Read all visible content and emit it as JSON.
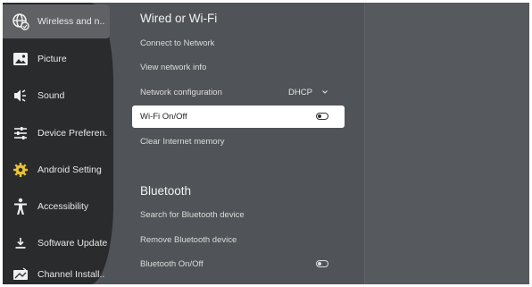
{
  "sidebar": {
    "items": [
      {
        "label": "Wireless and n..",
        "icon": "globe-network-icon",
        "selected": true
      },
      {
        "label": "Picture",
        "icon": "picture-icon"
      },
      {
        "label": "Sound",
        "icon": "speaker-icon"
      },
      {
        "label": "Device Preferen..",
        "icon": "sliders-icon"
      },
      {
        "label": "Android Setting",
        "icon": "gear-icon"
      },
      {
        "label": "Accessibility",
        "icon": "accessibility-person-icon"
      },
      {
        "label": "Software Update",
        "icon": "download-icon"
      },
      {
        "label": "Channel Install..",
        "icon": "tv-antenna-icon"
      }
    ]
  },
  "wired": {
    "title": "Wired or Wi-Fi",
    "items": [
      {
        "label": "Connect to Network"
      },
      {
        "label": "View network info"
      },
      {
        "label": "Network configuration",
        "value": "DHCP"
      },
      {
        "label": "Wi-Fi On/Off",
        "focused": true,
        "toggle": "off"
      },
      {
        "label": "Clear Internet memory"
      }
    ]
  },
  "bluetooth": {
    "title": "Bluetooth",
    "items": [
      {
        "label": "Search for Bluetooth device"
      },
      {
        "label": "Remove Bluetooth device"
      },
      {
        "label": "Bluetooth On/Off",
        "toggle": "off"
      }
    ]
  },
  "colors": {
    "sidebar_bg": "#2a2b2d",
    "panel_bg": "#505357",
    "selected_item_bg": "#5f6165",
    "focused_row_bg": "#ffffff"
  }
}
